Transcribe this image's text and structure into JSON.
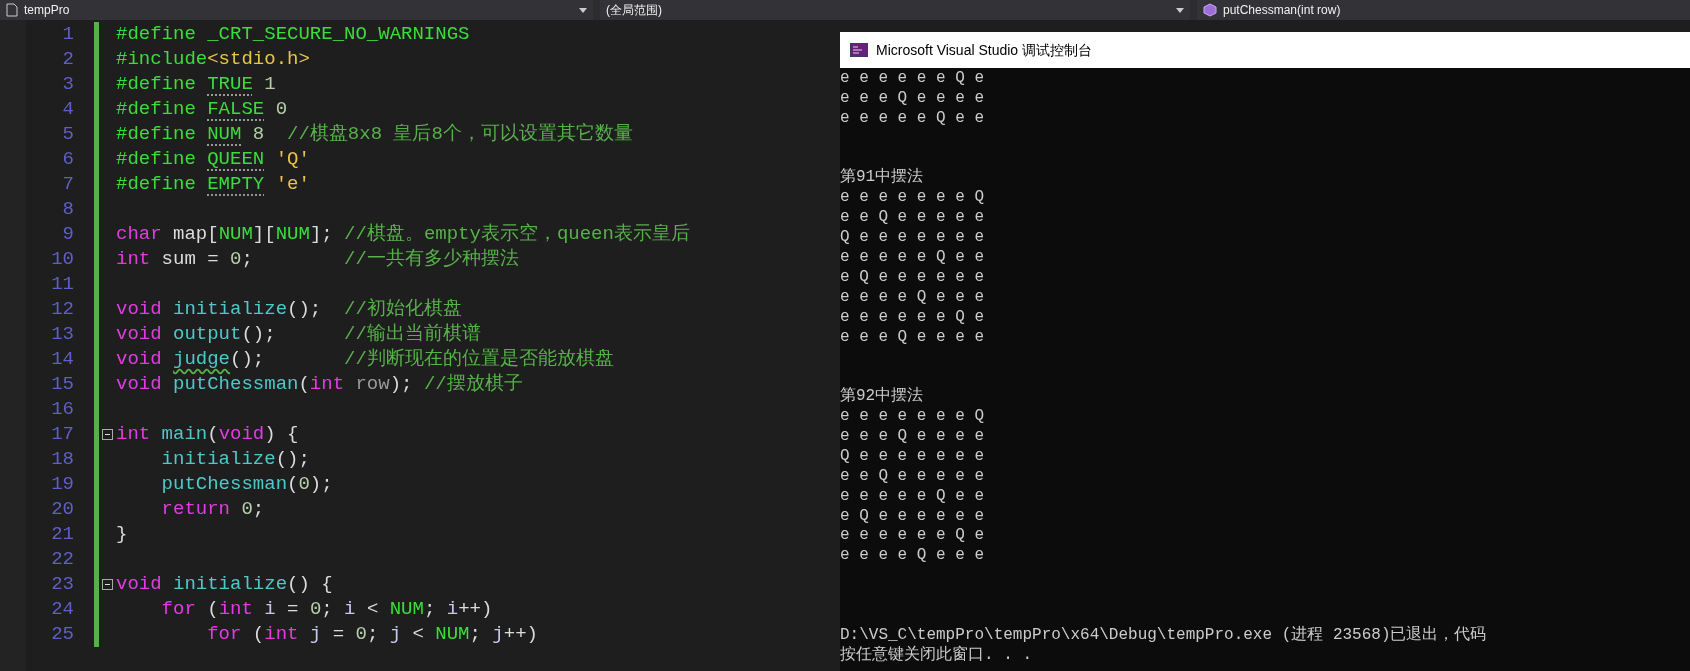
{
  "editor_toolbar": {
    "project": "tempPro",
    "scope": "(全局范围)",
    "member": "putChessman(int row)"
  },
  "code_lines": [
    {
      "number": "1",
      "changed": true,
      "fold": false,
      "tokens": [
        {
          "kind": "pp",
          "text": "#define _CRT_SECURE_NO_WARNINGS"
        }
      ]
    },
    {
      "number": "2",
      "changed": true,
      "fold": false,
      "tokens": [
        {
          "kind": "pp",
          "text": "#include"
        },
        {
          "kind": "str",
          "text": "<stdio.h>"
        }
      ]
    },
    {
      "number": "3",
      "changed": true,
      "fold": false,
      "tokens": [
        {
          "kind": "pp",
          "text": "#define "
        },
        {
          "kind": "macro_def",
          "text": "TRUE"
        },
        {
          "kind": "num",
          "text": " 1"
        }
      ]
    },
    {
      "number": "4",
      "changed": true,
      "fold": false,
      "tokens": [
        {
          "kind": "pp",
          "text": "#define "
        },
        {
          "kind": "macro_def",
          "text": "FALSE"
        },
        {
          "kind": "num",
          "text": " 0"
        }
      ]
    },
    {
      "number": "5",
      "changed": true,
      "fold": false,
      "tokens": [
        {
          "kind": "pp",
          "text": "#define "
        },
        {
          "kind": "macro_def",
          "text": "NUM"
        },
        {
          "kind": "num",
          "text": " 8  "
        },
        {
          "kind": "comment",
          "text": "//棋盘8x8 皇后8个，可以设置其它数量"
        }
      ]
    },
    {
      "number": "6",
      "changed": true,
      "fold": false,
      "tokens": [
        {
          "kind": "pp",
          "text": "#define "
        },
        {
          "kind": "macro_def",
          "text": "QUEEN"
        },
        {
          "kind": "str",
          "text": " 'Q'"
        }
      ]
    },
    {
      "number": "7",
      "changed": true,
      "fold": false,
      "tokens": [
        {
          "kind": "pp",
          "text": "#define "
        },
        {
          "kind": "macro_def",
          "text": "EMPTY"
        },
        {
          "kind": "str",
          "text": " 'e'"
        }
      ]
    },
    {
      "number": "8",
      "changed": true,
      "fold": false
    },
    {
      "number": "9",
      "changed": true,
      "fold": false,
      "tokens": [
        {
          "kind": "kw",
          "text": "char"
        },
        {
          "kind": "plain",
          "text": " map["
        },
        {
          "kind": "macro",
          "text": "NUM"
        },
        {
          "kind": "plain",
          "text": "]["
        },
        {
          "kind": "macro",
          "text": "NUM"
        },
        {
          "kind": "plain",
          "text": "]; "
        },
        {
          "kind": "comment",
          "text": "//棋盘。empty表示空，queen表示皇后"
        }
      ]
    },
    {
      "number": "10",
      "changed": true,
      "fold": false,
      "tokens": [
        {
          "kind": "kw",
          "text": "int"
        },
        {
          "kind": "plain",
          "text": " sum = "
        },
        {
          "kind": "num",
          "text": "0"
        },
        {
          "kind": "plain",
          "text": ";        "
        },
        {
          "kind": "comment",
          "text": "//一共有多少种摆法"
        }
      ]
    },
    {
      "number": "11",
      "changed": true,
      "fold": false
    },
    {
      "number": "12",
      "changed": true,
      "fold": false,
      "tokens": [
        {
          "kind": "kw",
          "text": "void "
        },
        {
          "kind": "fn",
          "text": "initialize"
        },
        {
          "kind": "plain",
          "text": "();  "
        },
        {
          "kind": "comment",
          "text": "//初始化棋盘"
        }
      ]
    },
    {
      "number": "13",
      "changed": true,
      "fold": false,
      "tokens": [
        {
          "kind": "kw",
          "text": "void "
        },
        {
          "kind": "fn",
          "text": "output"
        },
        {
          "kind": "plain",
          "text": "();      "
        },
        {
          "kind": "comment",
          "text": "//输出当前棋谱"
        }
      ]
    },
    {
      "number": "14",
      "changed": true,
      "fold": false,
      "tokens": [
        {
          "kind": "kw",
          "text": "void "
        },
        {
          "kind": "fn_warn",
          "text": "judge"
        },
        {
          "kind": "plain",
          "text": "();       "
        },
        {
          "kind": "comment",
          "text": "//判断现在的位置是否能放棋盘"
        }
      ]
    },
    {
      "number": "15",
      "changed": true,
      "fold": false,
      "tokens": [
        {
          "kind": "kw",
          "text": "void "
        },
        {
          "kind": "fn",
          "text": "putChessman"
        },
        {
          "kind": "plain",
          "text": "("
        },
        {
          "kind": "kw",
          "text": "int "
        },
        {
          "kind": "param",
          "text": "row"
        },
        {
          "kind": "plain",
          "text": "); "
        },
        {
          "kind": "comment",
          "text": "//摆放棋子"
        }
      ]
    },
    {
      "number": "16",
      "changed": true,
      "fold": false
    },
    {
      "number": "17",
      "changed": true,
      "fold": true,
      "tokens": [
        {
          "kind": "kw",
          "text": "int "
        },
        {
          "kind": "fn",
          "text": "main"
        },
        {
          "kind": "plain",
          "text": "("
        },
        {
          "kind": "kw",
          "text": "void"
        },
        {
          "kind": "plain",
          "text": ") {"
        }
      ]
    },
    {
      "number": "18",
      "changed": true,
      "fold": false,
      "tokens": [
        {
          "kind": "fn",
          "text": "    initialize"
        },
        {
          "kind": "plain",
          "text": "();"
        }
      ]
    },
    {
      "number": "19",
      "changed": true,
      "fold": false,
      "tokens": [
        {
          "kind": "fn",
          "text": "    putChessman"
        },
        {
          "kind": "plain",
          "text": "("
        },
        {
          "kind": "num",
          "text": "0"
        },
        {
          "kind": "plain",
          "text": ");"
        }
      ]
    },
    {
      "number": "20",
      "changed": true,
      "fold": false,
      "tokens": [
        {
          "kind": "kw",
          "text": "    return"
        },
        {
          "kind": "num",
          "text": " 0"
        },
        {
          "kind": "plain",
          "text": ";"
        }
      ]
    },
    {
      "number": "21",
      "changed": true,
      "fold": false,
      "tokens": [
        {
          "kind": "plain",
          "text": "}"
        }
      ]
    },
    {
      "number": "22",
      "changed": true,
      "fold": false
    },
    {
      "number": "23",
      "changed": true,
      "fold": true,
      "tokens": [
        {
          "kind": "kw",
          "text": "void "
        },
        {
          "kind": "fn",
          "text": "initialize"
        },
        {
          "kind": "plain",
          "text": "() {"
        }
      ]
    },
    {
      "number": "24",
      "changed": true,
      "fold": false,
      "tokens": [
        {
          "kind": "kw",
          "text": "    for"
        },
        {
          "kind": "plain",
          "text": " ("
        },
        {
          "kind": "kw",
          "text": "int "
        },
        {
          "kind": "var",
          "text": "i"
        },
        {
          "kind": "plain",
          "text": " = "
        },
        {
          "kind": "num",
          "text": "0"
        },
        {
          "kind": "plain",
          "text": "; "
        },
        {
          "kind": "var",
          "text": "i"
        },
        {
          "kind": "plain",
          "text": " < "
        },
        {
          "kind": "macro",
          "text": "NUM"
        },
        {
          "kind": "plain",
          "text": "; "
        },
        {
          "kind": "var",
          "text": "i"
        },
        {
          "kind": "plain",
          "text": "++)"
        }
      ]
    },
    {
      "number": "25",
      "changed": true,
      "fold": false,
      "tokens": [
        {
          "kind": "kw",
          "text": "        for"
        },
        {
          "kind": "plain",
          "text": " ("
        },
        {
          "kind": "kw",
          "text": "int "
        },
        {
          "kind": "var",
          "text": "j"
        },
        {
          "kind": "plain",
          "text": " = "
        },
        {
          "kind": "num",
          "text": "0"
        },
        {
          "kind": "plain",
          "text": "; "
        },
        {
          "kind": "var",
          "text": "j"
        },
        {
          "kind": "plain",
          "text": " < "
        },
        {
          "kind": "macro",
          "text": "NUM"
        },
        {
          "kind": "plain",
          "text": "; "
        },
        {
          "kind": "var",
          "text": "j"
        },
        {
          "kind": "plain",
          "text": "++)"
        }
      ]
    }
  ],
  "console": {
    "title": "Microsoft Visual Studio 调试控制台",
    "lines": [
      {
        "kind": "text",
        "text": "e e e e e e Q e"
      },
      {
        "kind": "text",
        "text": "e e e Q e e e e"
      },
      {
        "kind": "text",
        "text": "e e e e e Q e e"
      },
      {
        "kind": "blank"
      },
      {
        "kind": "blank"
      },
      {
        "kind": "text",
        "text": "第91中摆法"
      },
      {
        "kind": "text",
        "text": "e e e e e e e Q"
      },
      {
        "kind": "text",
        "text": "e e Q e e e e e"
      },
      {
        "kind": "text",
        "text": "Q e e e e e e e"
      },
      {
        "kind": "text",
        "text": "e e e e e Q e e"
      },
      {
        "kind": "text",
        "text": "e Q e e e e e e"
      },
      {
        "kind": "text",
        "text": "e e e e Q e e e"
      },
      {
        "kind": "text",
        "text": "e e e e e e Q e"
      },
      {
        "kind": "text",
        "text": "e e e Q e e e e"
      },
      {
        "kind": "blank"
      },
      {
        "kind": "blank"
      },
      {
        "kind": "text",
        "text": "第92中摆法"
      },
      {
        "kind": "text",
        "text": "e e e e e e e Q"
      },
      {
        "kind": "text",
        "text": "e e e Q e e e e"
      },
      {
        "kind": "text",
        "text": "Q e e e e e e e"
      },
      {
        "kind": "text",
        "text": "e e Q e e e e e"
      },
      {
        "kind": "text",
        "text": "e e e e e Q e e"
      },
      {
        "kind": "text",
        "text": "e Q e e e e e e"
      },
      {
        "kind": "text",
        "text": "e e e e e e Q e"
      },
      {
        "kind": "text",
        "text": "e e e e Q e e e"
      },
      {
        "kind": "blank"
      },
      {
        "kind": "blank"
      },
      {
        "kind": "blank"
      },
      {
        "kind": "text",
        "text": "D:\\VS_C\\tempPro\\tempPro\\x64\\Debug\\tempPro.exe (进程 23568)已退出，代码"
      },
      {
        "kind": "text",
        "text": "按任意键关闭此窗口. . ."
      }
    ]
  }
}
